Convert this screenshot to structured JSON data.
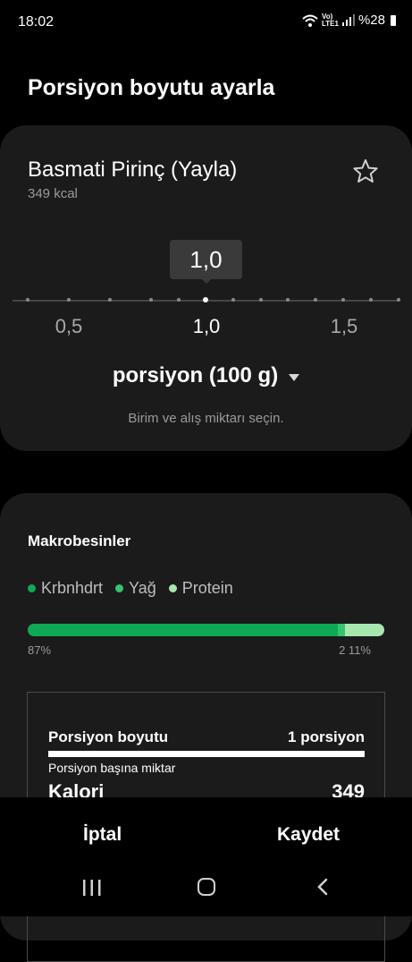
{
  "status": {
    "time": "18:02",
    "network": "LTE1",
    "volte": "Vo)",
    "battery": "%28"
  },
  "page_title": "Porsiyon boyutu ayarla",
  "food": {
    "name": "Basmati Pirinç (Yayla)",
    "kcal": "349 kcal"
  },
  "picker": {
    "current_value": "1,0",
    "ticks": [
      {
        "label": "0,5",
        "active": false
      },
      {
        "label": "1,0",
        "active": true
      },
      {
        "label": "1,5",
        "active": false
      }
    ],
    "unit_label": "porsiyon (100 g)",
    "hint": "Birim ve alış miktarı seçin."
  },
  "macros": {
    "title": "Makrobesinler",
    "legend": [
      {
        "label": "Krbnhdrt",
        "color": "#0eaa55"
      },
      {
        "label": "Yağ",
        "color": "#35c46d"
      },
      {
        "label": "Protein",
        "color": "#a6e7b0"
      }
    ],
    "bar_fractions": [
      0.87,
      0.02,
      0.11
    ],
    "pct_left": "87%",
    "pct_right": "2 11%"
  },
  "nutrition": {
    "serving_size_label": "Porsiyon boyutu",
    "serving_size_value": "1 porsiyon",
    "per_serving": "Porsiyon başına miktar",
    "calories_label": "Kalori",
    "calories_value": "349"
  },
  "actions": {
    "cancel": "İptal",
    "save": "Kaydet"
  }
}
